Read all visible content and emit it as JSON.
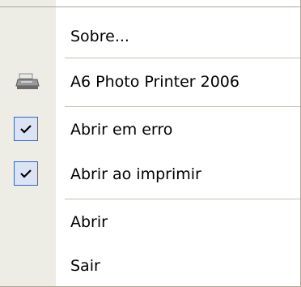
{
  "menu": {
    "items": [
      {
        "label": "Sobre...",
        "icon": "none",
        "checked": false
      },
      {
        "label": "A6 Photo Printer 2006",
        "icon": "printer-icon",
        "checked": false
      },
      {
        "label": "Abrir em erro",
        "icon": "check-icon",
        "checked": true
      },
      {
        "label": "Abrir ao imprimir",
        "icon": "check-icon",
        "checked": true
      },
      {
        "label": "Abrir",
        "icon": "none",
        "checked": false
      },
      {
        "label": "Sair",
        "icon": "none",
        "checked": false
      }
    ]
  },
  "colors": {
    "gutter": "#eeede5",
    "check_highlight": "#dbe3f5",
    "check_border": "#316ac5",
    "separator": "#c5c2b2"
  }
}
